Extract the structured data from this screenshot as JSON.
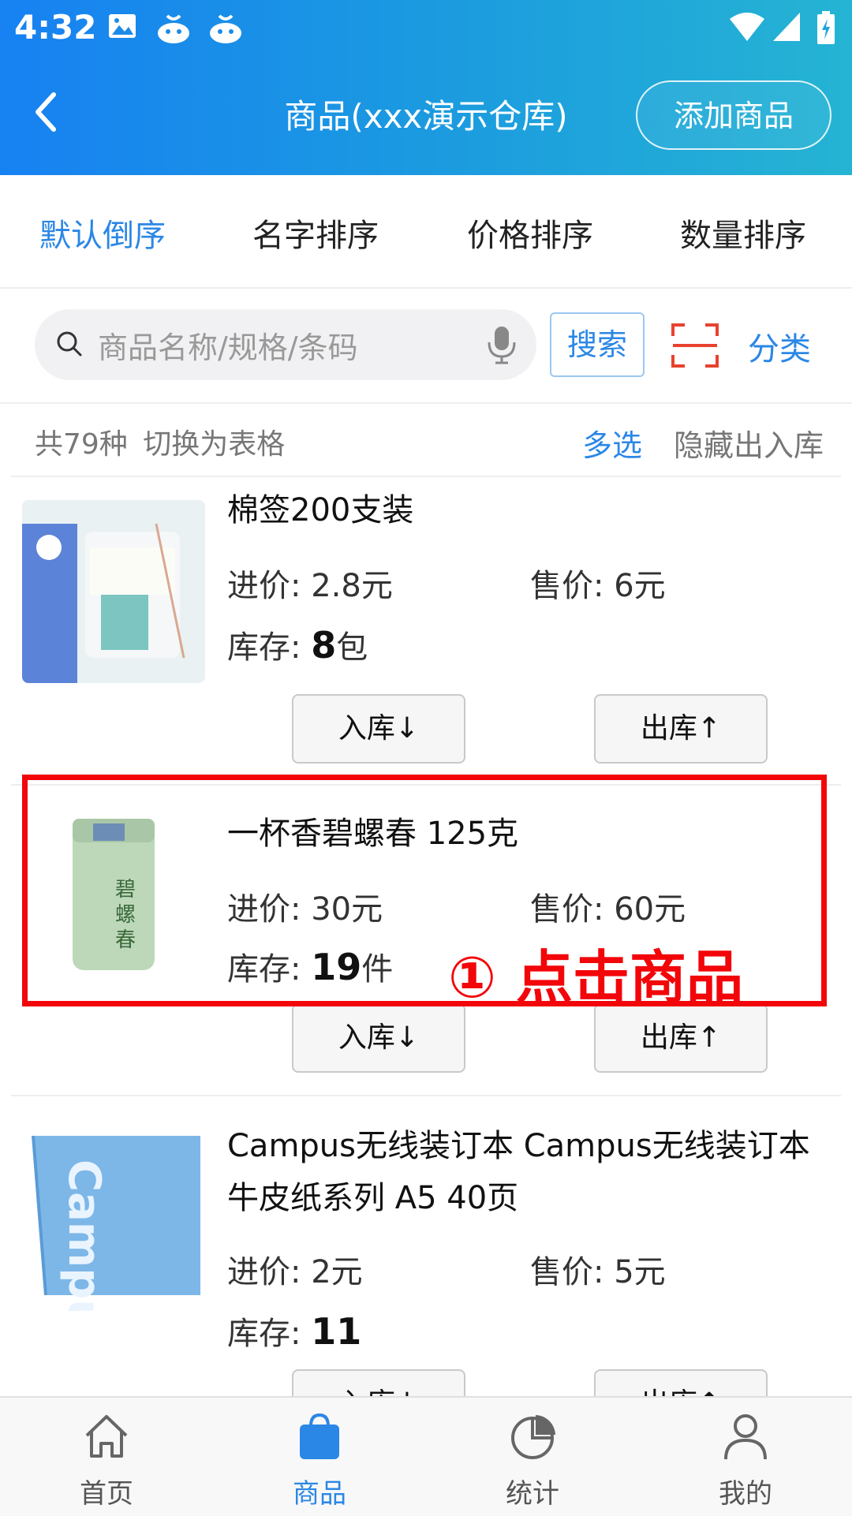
{
  "status_bar": {
    "time": "4:32"
  },
  "header": {
    "title": "商品(xxx演示仓库)",
    "add_button": "添加商品"
  },
  "sort_tabs": [
    {
      "label": "默认倒序",
      "active": true
    },
    {
      "label": "名字排序",
      "active": false
    },
    {
      "label": "价格排序",
      "active": false
    },
    {
      "label": "数量排序",
      "active": false
    }
  ],
  "search": {
    "placeholder": "商品名称/规格/条码",
    "button": "搜索",
    "category": "分类"
  },
  "info": {
    "count_text": "共79种",
    "switch_text": "切换为表格",
    "multi_select": "多选",
    "hide_io": "隐藏出入库"
  },
  "products": [
    {
      "name": "棉签200支装",
      "cost_label": "进价:",
      "cost": "2.8元",
      "price_label": "售价:",
      "price": "6元",
      "stock_label": "库存:",
      "stock": "8",
      "unit": "包",
      "in_button": "入库↓",
      "out_button": "出库↑"
    },
    {
      "name": "一杯香碧螺春  125克",
      "cost_label": "进价:",
      "cost": "30元",
      "price_label": "售价:",
      "price": "60元",
      "stock_label": "库存:",
      "stock": "19",
      "unit": "件",
      "in_button": "入库↓",
      "out_button": "出库↑"
    },
    {
      "name": "Campus无线装订本  Campus无线装订本 牛皮纸系列 A5 40页",
      "cost_label": "进价:",
      "cost": "2元",
      "price_label": "售价:",
      "price": "5元",
      "stock_label": "库存:",
      "stock": "11",
      "unit": "",
      "in_button": "入库↓",
      "out_button": "出库↑"
    }
  ],
  "annotation": {
    "text": "① 点击商品"
  },
  "bottom_nav": [
    {
      "label": "首页",
      "icon": "home-icon",
      "active": false
    },
    {
      "label": "商品",
      "icon": "shopping-bag-icon",
      "active": true
    },
    {
      "label": "统计",
      "icon": "pie-chart-icon",
      "active": false
    },
    {
      "label": "我的",
      "icon": "user-icon",
      "active": false
    }
  ],
  "colors": {
    "accent": "#2b87e6",
    "annotation_red": "#f2060a",
    "header_start": "#1781f2",
    "header_end": "#25b4d3"
  }
}
